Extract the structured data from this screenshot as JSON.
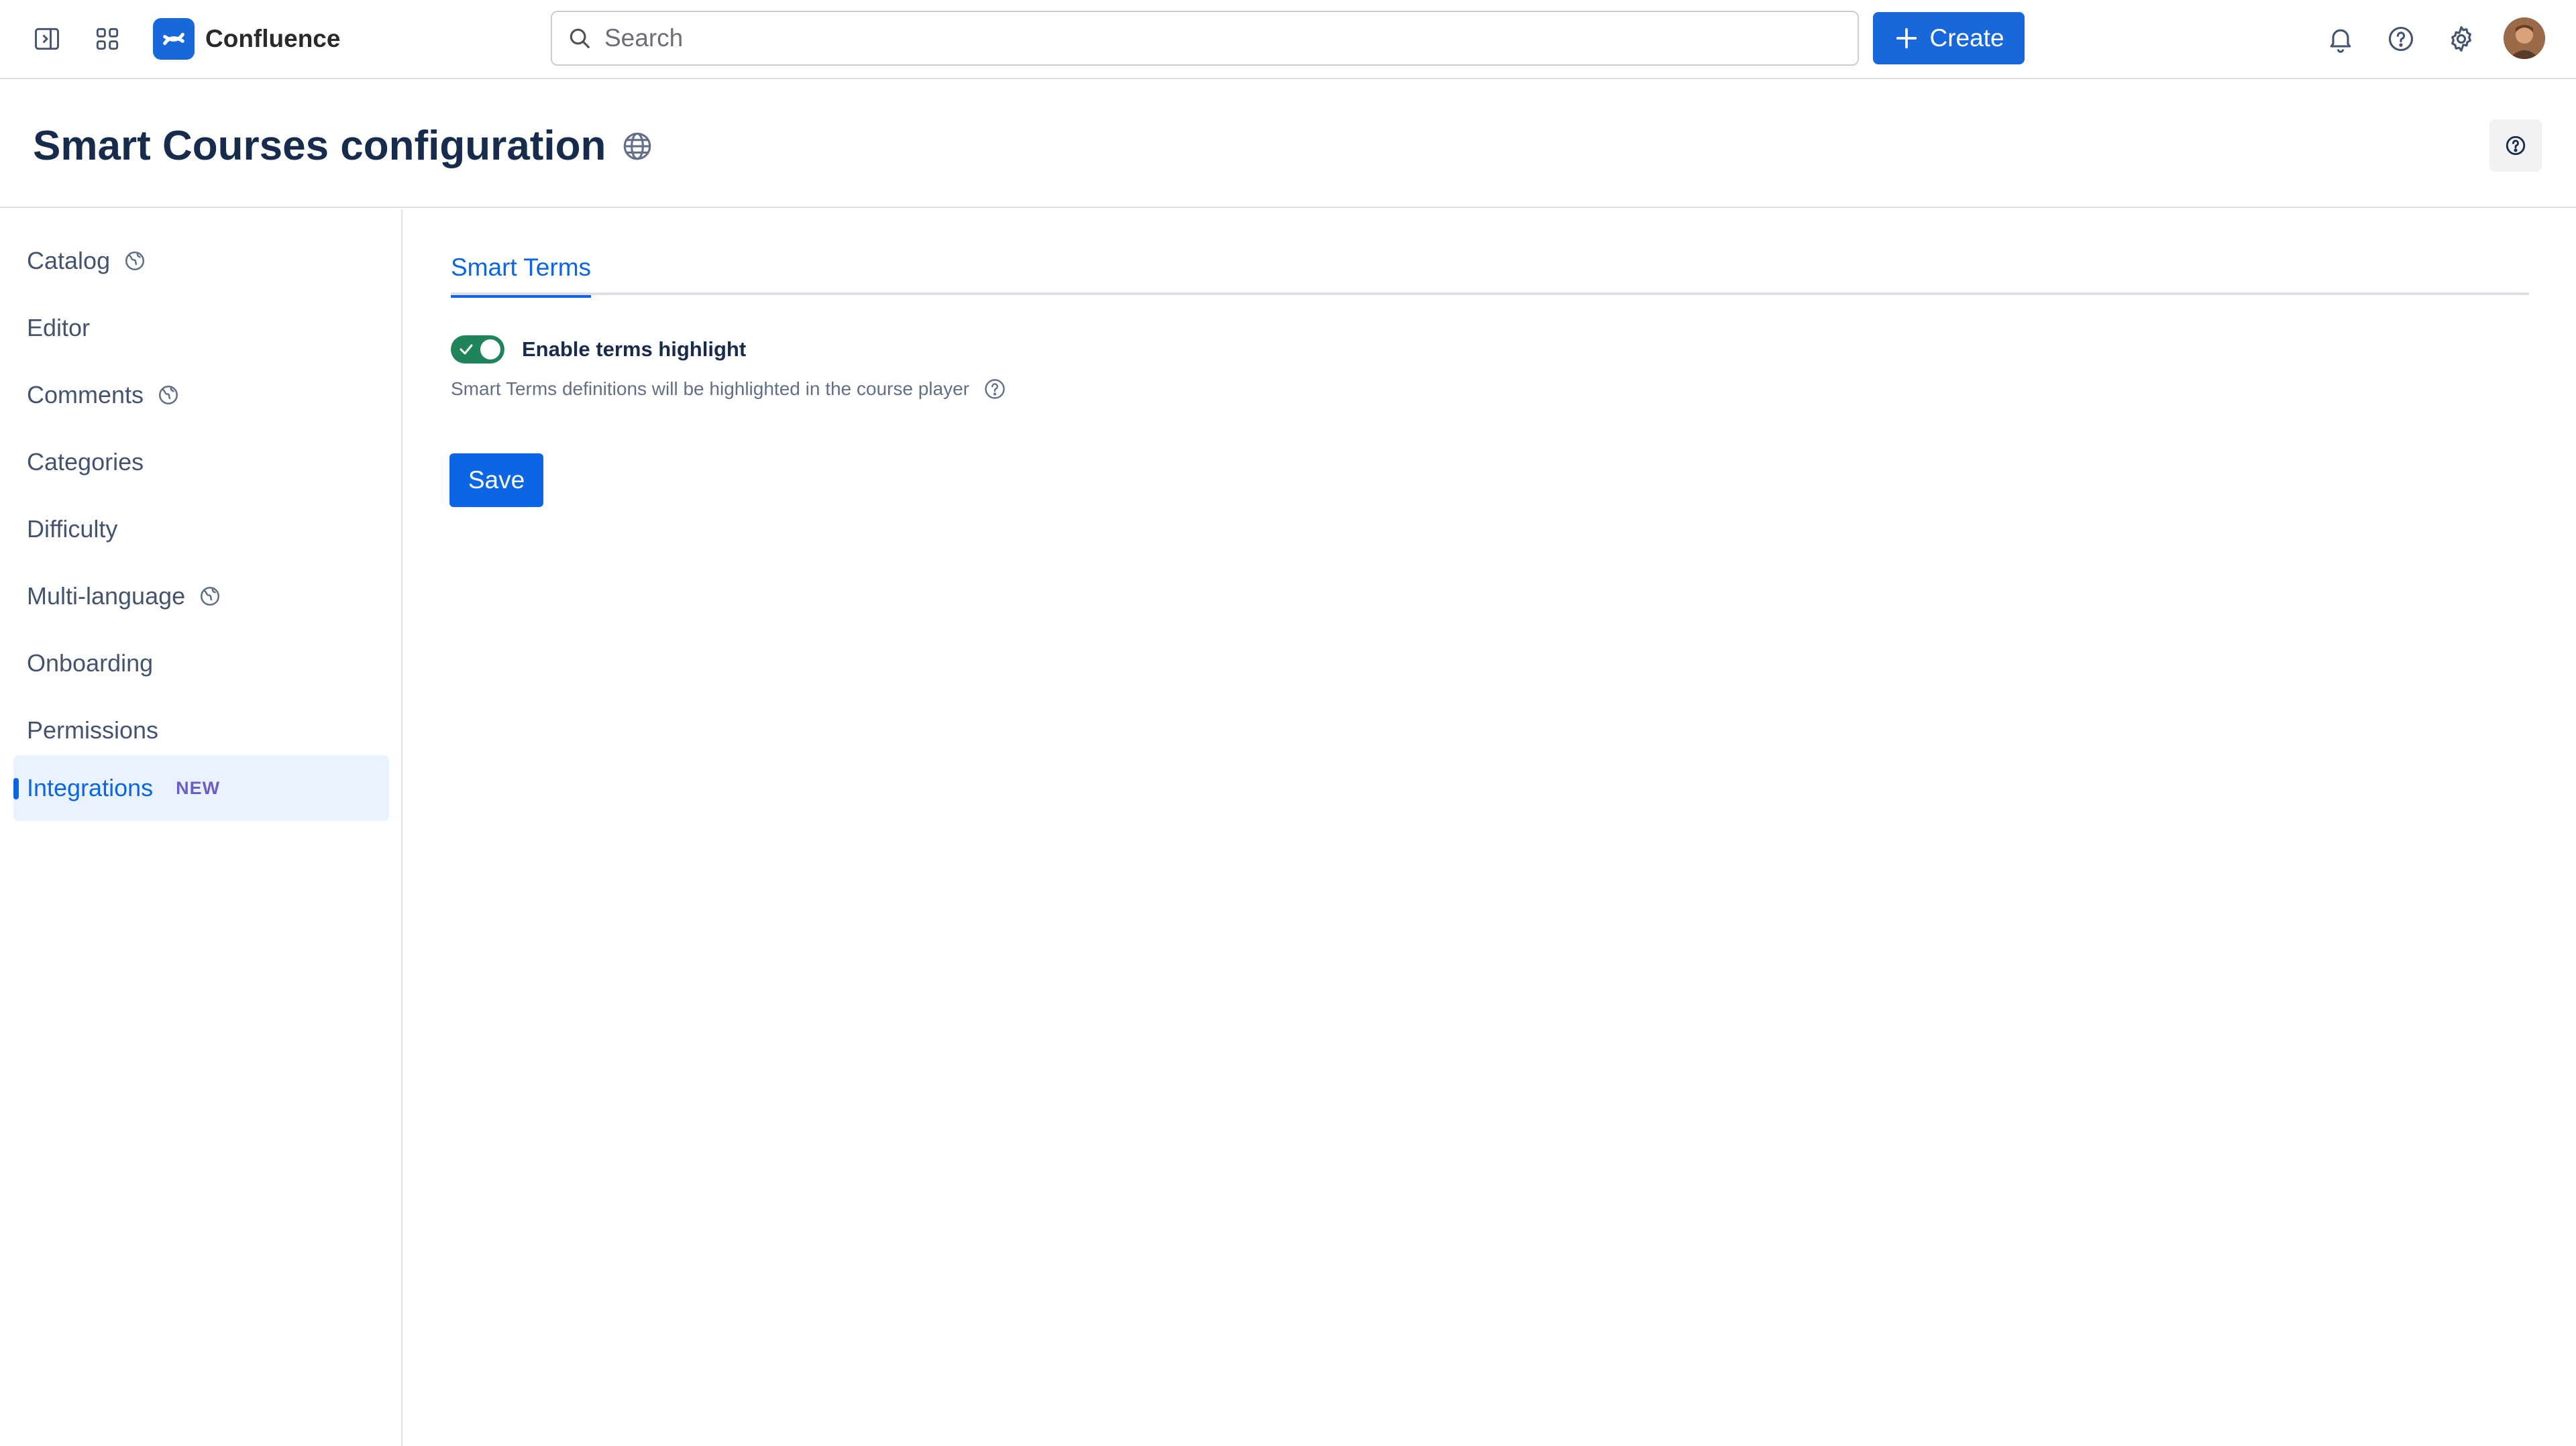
{
  "topnav": {
    "brand_name": "Confluence",
    "search_placeholder": "Search",
    "create_label": "Create",
    "icons": [
      "sidebar-toggle-icon",
      "app-switcher-icon",
      "bell-icon",
      "help-icon",
      "gear-icon"
    ]
  },
  "page": {
    "title": "Smart Courses configuration"
  },
  "sidebar": {
    "items": [
      {
        "label": "Catalog",
        "globe": true
      },
      {
        "label": "Editor",
        "globe": false
      },
      {
        "label": "Comments",
        "globe": true
      },
      {
        "label": "Categories",
        "globe": false
      },
      {
        "label": "Difficulty",
        "globe": false
      },
      {
        "label": "Multi-language",
        "globe": true
      },
      {
        "label": "Onboarding",
        "globe": false
      },
      {
        "label": "Permissions",
        "globe": false
      },
      {
        "label": "Integrations",
        "globe": false,
        "badge": "NEW",
        "active": true
      }
    ]
  },
  "main": {
    "tab_label": "Smart Terms",
    "toggle_label": "Enable terms highlight",
    "toggle_on": true,
    "help_text": "Smart Terms definitions will be highlighted in the course player",
    "save_label": "Save"
  },
  "colors": {
    "brand": "#1868db",
    "accent": "#0c66e4",
    "toggle_on": "#1f845a",
    "badge_new": "#6e5dc6"
  }
}
